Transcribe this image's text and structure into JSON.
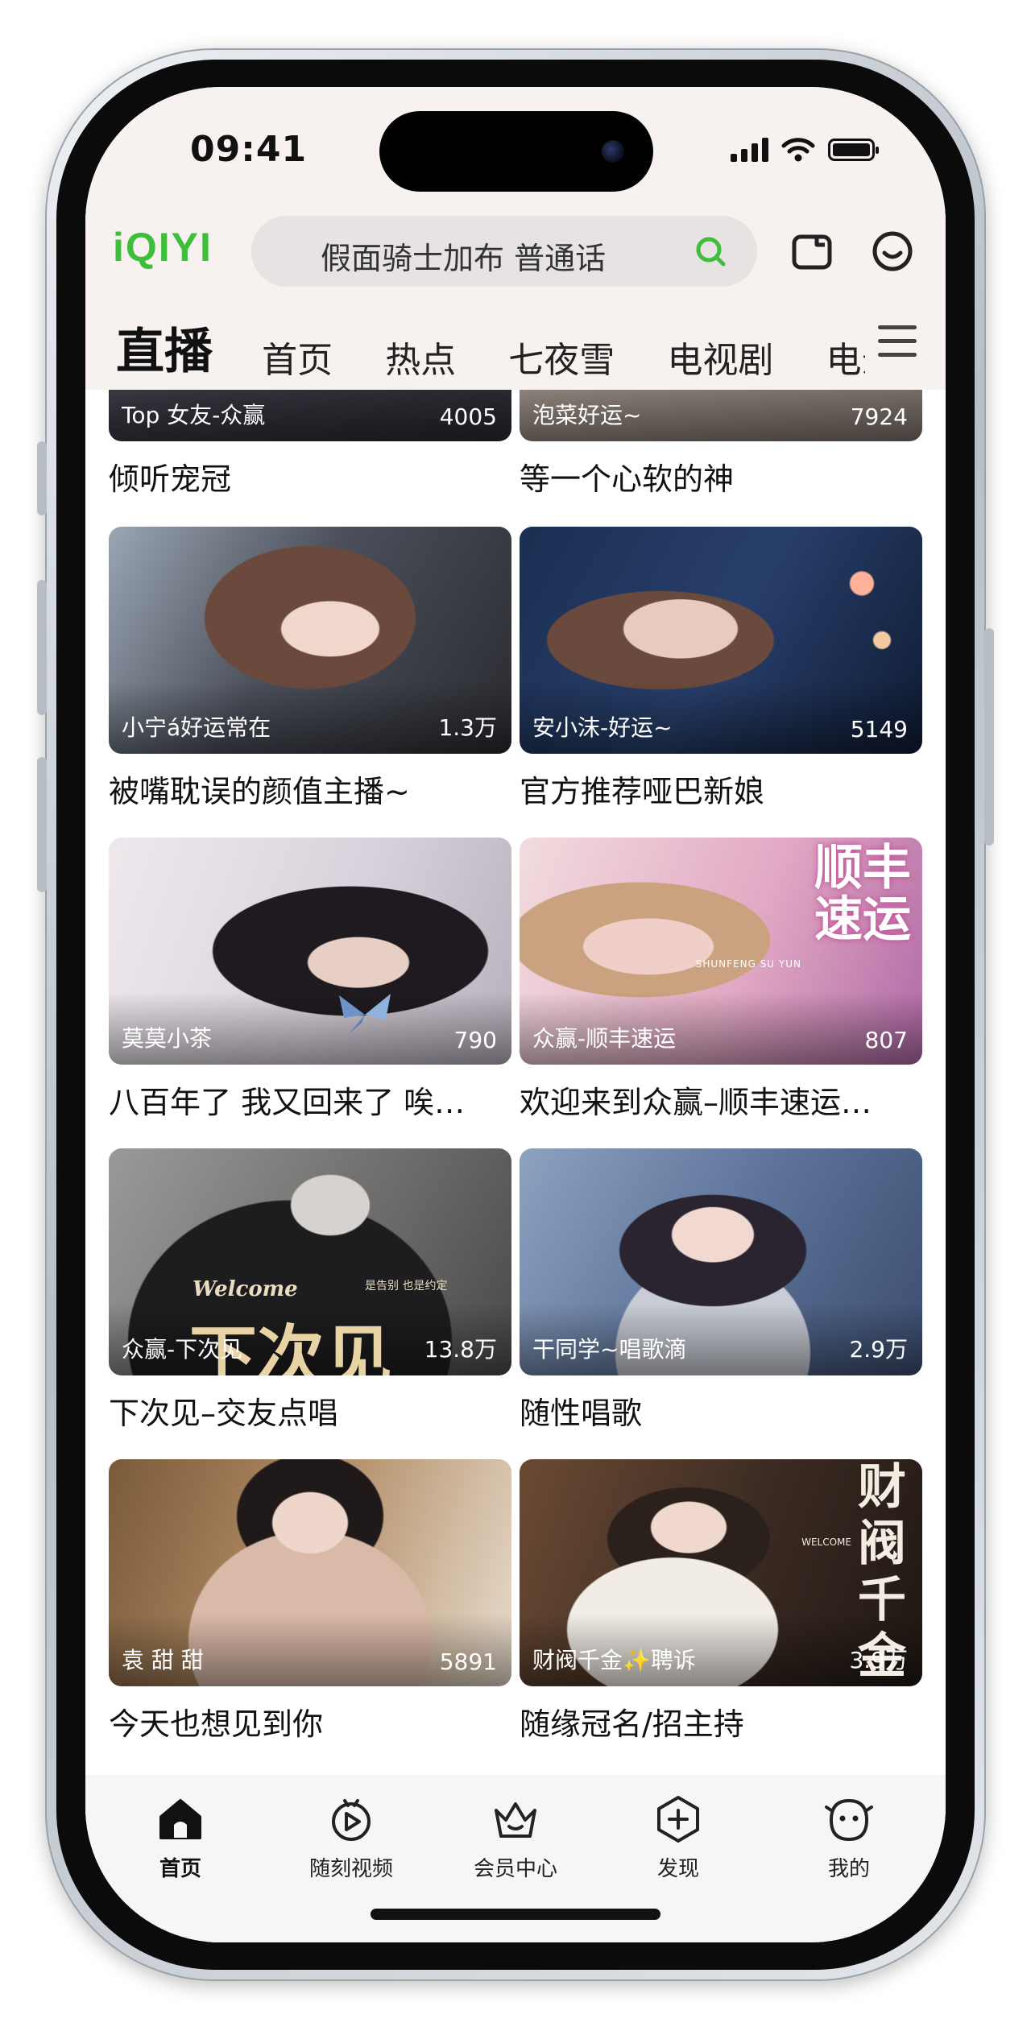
{
  "status_bar": {
    "time": "09:41"
  },
  "header": {
    "logo": "iQIYI",
    "search_text": "假面骑士加布 普通话"
  },
  "tabs": [
    "直播",
    "首页",
    "热点",
    "七夜雪",
    "电视剧",
    "电影"
  ],
  "cards": [
    {
      "title": "倾听宠冠",
      "name": "Top 女友-众赢",
      "count": "4005"
    },
    {
      "title": "等一个心软的神",
      "name": "泡菜好运~",
      "count": "7924"
    },
    {
      "title": "被嘴耽误的颜值主播~",
      "name": "小宁á好运常在",
      "count": "1.3万"
    },
    {
      "title": "官方推荐哑巴新娘",
      "name": "安小沫-好运~",
      "count": "5149"
    },
    {
      "title": "八百年了 我又回来了 唉…",
      "name": "莫莫小茶",
      "count": "790"
    },
    {
      "title": "欢迎来到众赢–顺丰速运…",
      "name": "众赢-顺丰速运",
      "count": "807"
    },
    {
      "title": "下次见–交友点唱",
      "name": "众赢-下次见",
      "count": "13.8万"
    },
    {
      "title": "随性唱歌",
      "name": "干同学~唱歌滴",
      "count": "2.9万"
    },
    {
      "title": "今天也想见到你",
      "name": "袁 甜 甜",
      "count": "5891"
    },
    {
      "title": "随缘冠名/招主持",
      "name": "财阀千金✨聘诉",
      "count": "3.9万"
    }
  ],
  "thumb_text": {
    "shunfeng": "顺丰速运",
    "shunfeng_en": "SHUNFENG SU YUN",
    "welcome": "Welcome",
    "xiacijian": "下次见",
    "gaobie": "是告别  也是约定",
    "caifa": "财阀千金",
    "caifa_welcome": "WELCOME"
  },
  "bottom_nav": [
    {
      "label": "首页",
      "icon": "home-icon",
      "active": true
    },
    {
      "label": "随刻视频",
      "icon": "play-circle-icon",
      "active": false
    },
    {
      "label": "会员中心",
      "icon": "crown-icon",
      "active": false
    },
    {
      "label": "发现",
      "icon": "discover-plus-icon",
      "active": false
    },
    {
      "label": "我的",
      "icon": "profile-face-icon",
      "active": false
    }
  ],
  "colors": {
    "brand_green": "#3fbe3b",
    "header_bg": "#f7f2ef",
    "text": "#111111"
  }
}
